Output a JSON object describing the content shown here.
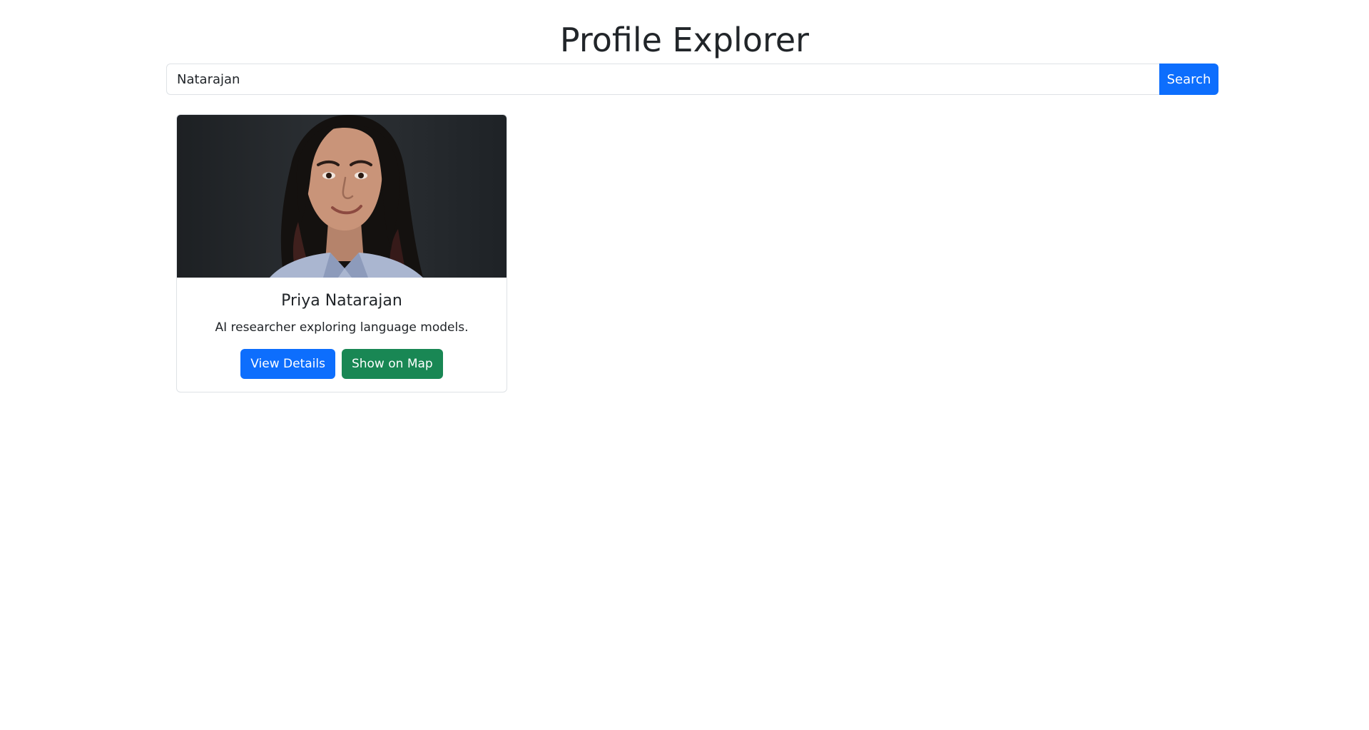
{
  "header": {
    "title": "Profile Explorer"
  },
  "search": {
    "value": "Natarajan",
    "button_label": "Search"
  },
  "results": [
    {
      "photo_icon": "profile-photo",
      "name": "Priya Natarajan",
      "bio": "AI researcher exploring language models.",
      "details_label": "View Details",
      "map_label": "Show on Map"
    }
  ],
  "colors": {
    "primary": "#0d6efd",
    "success": "#198754",
    "text": "#212529",
    "border": "#dee2e6"
  }
}
